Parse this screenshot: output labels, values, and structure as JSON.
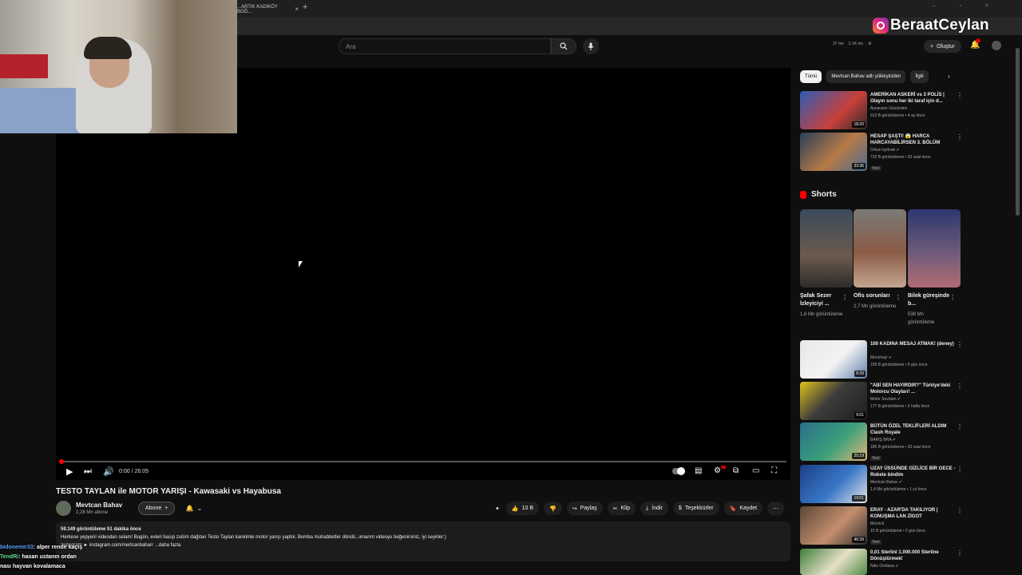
{
  "browser": {
    "tab_title": "...ARTIK KADIKÖY BOĞ...",
    "tab_close": "×",
    "new_tab": "+",
    "window_controls": "–   ▫   ×"
  },
  "overlay": {
    "streamer_name": "BeraatCeylan",
    "chat": [
      {
        "user": "bidonemir33",
        "text": ": alper rende kaçış"
      },
      {
        "user": "TendRi",
        "text": ": hasan ustanın ordan"
      },
      {
        "user": "",
        "text": "nası hayvan kovalamaca"
      }
    ]
  },
  "header": {
    "search_placeholder": "Ara",
    "stats": [
      "37 ms",
      "2.1K ms"
    ],
    "create_label": "Oluştur",
    "notification_count": "9+"
  },
  "player": {
    "time": "0:00 / 26:05",
    "progress_fraction": 0.0
  },
  "video": {
    "title": "TESTO TAYLAN ile MOTOR YARIŞI - Kawasaki vs Hayabusa",
    "channel": "Mevtcan Bahav",
    "subscribers": "2,28 Mn abone",
    "subscribe_label": "Abone",
    "actions": {
      "like_count": "10 B",
      "share": "Paylaş",
      "clip": "Klip",
      "download": "İndir",
      "thanks": "Teşekkürler",
      "save": "Kaydet"
    },
    "description": {
      "stats": "59.149 görüntüleme  51 dakika önce",
      "line1": "Herkese yepyeni videodan selam! Bugün, evleri basıp zulüm dağıtan Testo Taylan kankimle motor yarışı yaptık. Bomba muhabbetler döndü, umarım videoyu beğenirsiniz, iyi seyirler;)",
      "line2": "Instagram ► instagram.com/mertcanbaharr ...daha fazla"
    }
  },
  "sidebar": {
    "chips": [
      "Tümü",
      "Mevtcan Bahav adlı yükleyiciden",
      "İlgili"
    ],
    "recs_top": [
      {
        "title": "AMERİKAN ASKERİ vs 3 POLİS | Olayın sonu her iki taraf için d...",
        "channel": "Aynavizer Gözünden",
        "views": "913 B görüntüleme • 4 ay önce",
        "duration": "18:20",
        "badge": ""
      },
      {
        "title": "HESAP ŞAŞTI! 😱 HARCA HARCAYABİLİRSEN 3. BÖLÜM",
        "channel": "Orkun Işıtmak ✔",
        "views": "733 B görüntüleme • 20 saat önce",
        "duration": "33:36",
        "badge": "Yeni"
      }
    ],
    "shorts_title": "Shorts",
    "shorts": [
      {
        "title": "Şafak Sezer İzleyiciyi ...",
        "views": "1,8 Mn görüntüleme"
      },
      {
        "title": "Ofis sorunları",
        "views": "2,7 Mn görüntüleme"
      },
      {
        "title": "Bilek güreşinde b...",
        "views": "538 Mn görüntüleme"
      }
    ],
    "recs_bottom": [
      {
        "title": "100 KADINA MESAJ ATMAK! (deney)",
        "channel": "Monchayi ✔",
        "views": "199 B görüntüleme • 9 gün önce",
        "duration": "8:39",
        "badge": ""
      },
      {
        "title": "\"ABİ SEN HAYIRDIR?\" Türkiye'deki Motorcu Olayları! ...",
        "channel": "Motor Sevdam ✔",
        "views": "177 B görüntüleme • 2 hafta önce",
        "duration": "9:01",
        "badge": ""
      },
      {
        "title": "BÜTÜN ÖZEL TEKLİFLERİ ALDIM Clash Royale",
        "channel": "BARIŞ BRA ✔",
        "views": "185 B görüntüleme • 20 saat önce",
        "duration": "25:19",
        "badge": "Yeni"
      },
      {
        "title": "UZAY ÜSSÜNDE GİZLİCE BİR GECE - Rokete bindim",
        "channel": "Mevtcan Bahav ✔",
        "views": "1,4 Mn görüntüleme • 1 yıl önce",
        "duration": "19:01",
        "badge": ""
      },
      {
        "title": "ERAY - AZAR'DA TAKILIYOR | KONUŞMA LAN ZİGOT",
        "channel": "Morvick",
        "views": "15 B görüntüleme • 2 gün önce",
        "duration": "46:39",
        "badge": "Yeni"
      },
      {
        "title": "0,01 Sterlini 1.000.000 Sterline Dönüştürmek!",
        "channel": "Niko Omilana ✔",
        "views": "",
        "duration": "",
        "badge": ""
      }
    ]
  },
  "colors": {
    "accent_red": "#ff0000",
    "bg": "#0f0f0f"
  }
}
